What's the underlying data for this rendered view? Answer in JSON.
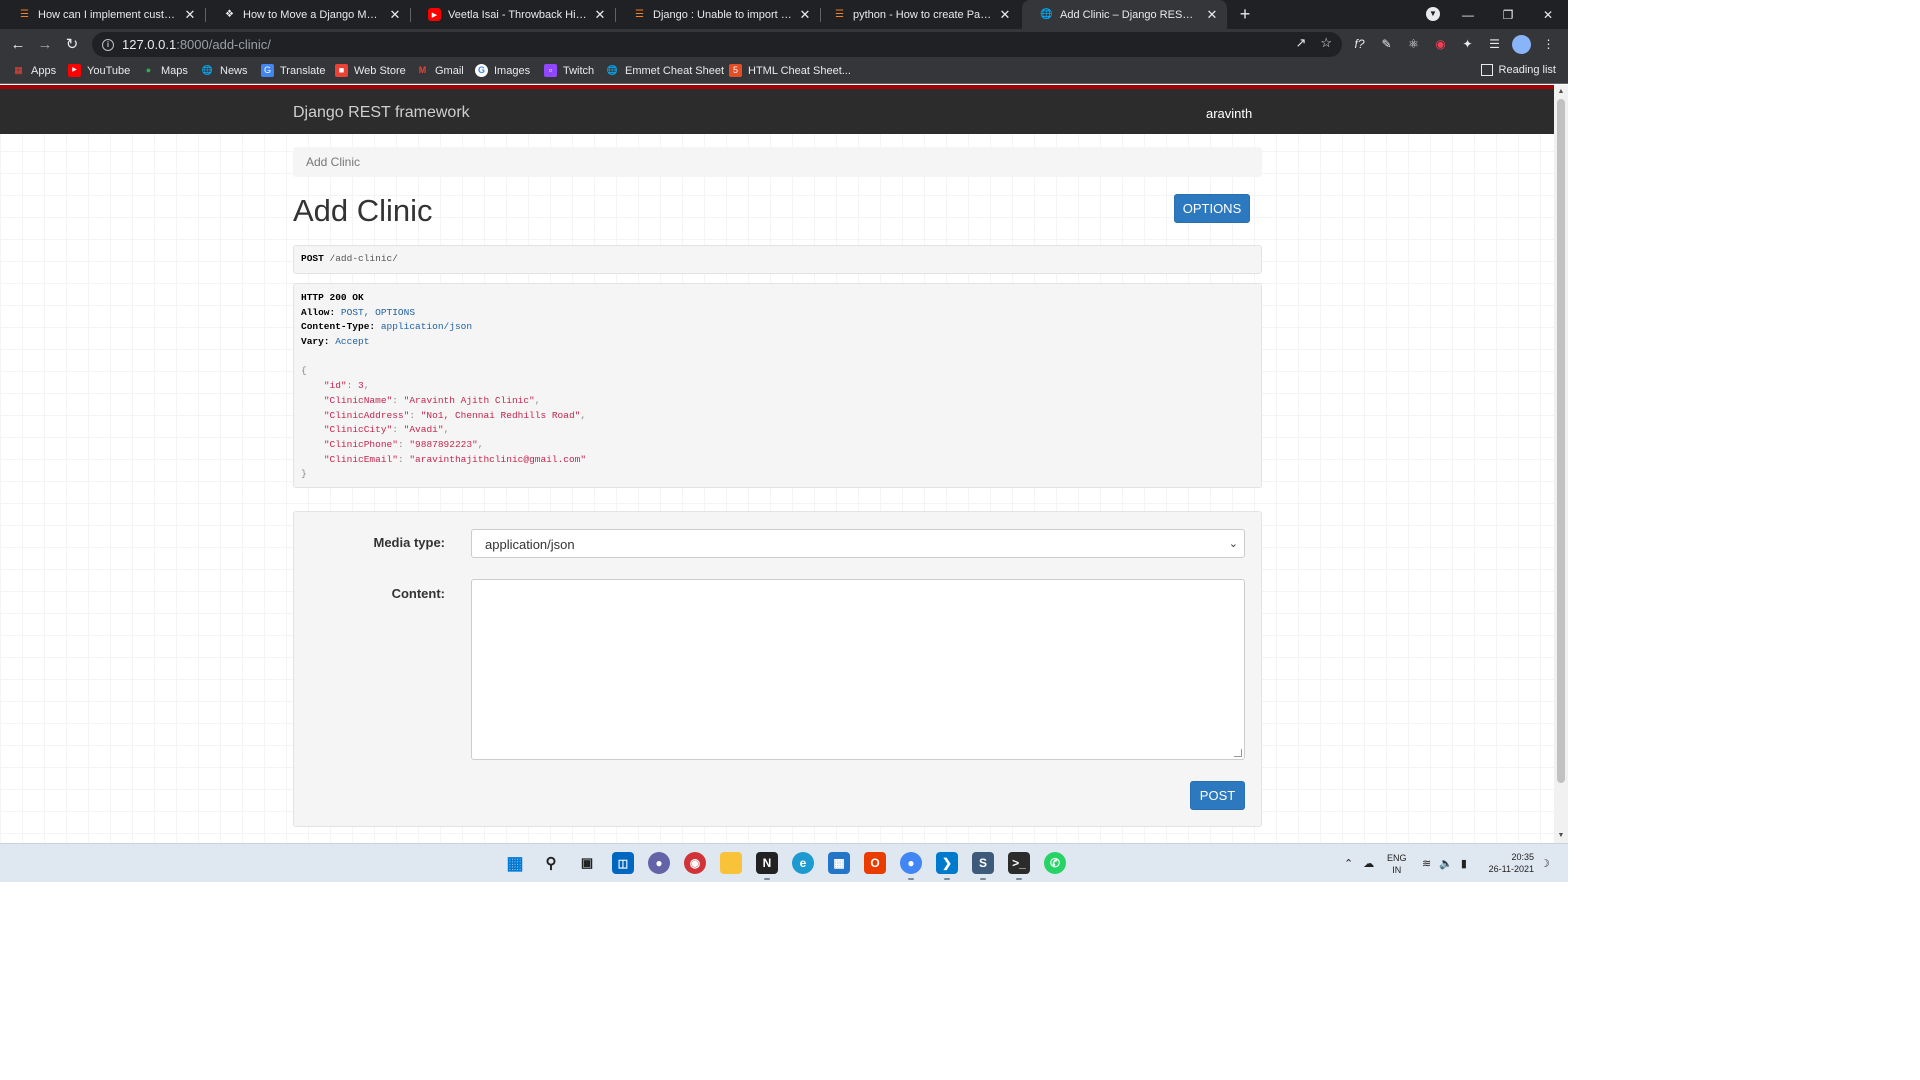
{
  "browser": {
    "tabs": [
      {
        "title": "How can I implement custom use",
        "icon": "stackoverflow-icon",
        "color": "#f48024"
      },
      {
        "title": "How to Move a Django Model to",
        "icon": "site-icon",
        "color": "#e8eaed"
      },
      {
        "title": "Veetla Isai - Throwback Hits Juke",
        "icon": "youtube-icon",
        "color": "#ff0000"
      },
      {
        "title": "Django : Unable to import mode",
        "icon": "stackoverflow-icon",
        "color": "#f48024"
      },
      {
        "title": "python - How to create Passwor",
        "icon": "stackoverflow-icon",
        "color": "#f48024"
      },
      {
        "title": "Add Clinic – Django REST framew",
        "icon": "globe-icon",
        "color": "#e8eaed"
      }
    ],
    "address": {
      "host": "127.0.0.1",
      "rest": ":8000/add-clinic/"
    },
    "bookmarks": [
      {
        "label": "Apps",
        "icon": "apps-grid-icon",
        "color": "#ea4335"
      },
      {
        "label": "YouTube",
        "icon": "youtube-icon",
        "color": "#ff0000"
      },
      {
        "label": "Maps",
        "icon": "maps-pin-icon",
        "color": "#34a853"
      },
      {
        "label": "News",
        "icon": "globe-icon",
        "color": "#e8eaed"
      },
      {
        "label": "Translate",
        "icon": "translate-icon",
        "color": "#4285f4"
      },
      {
        "label": "Web Store",
        "icon": "webstore-icon",
        "color": "#ea4335"
      },
      {
        "label": "Gmail",
        "icon": "gmail-icon",
        "color": "#ea4335"
      },
      {
        "label": "Images",
        "icon": "google-icon",
        "color": "#4285f4"
      },
      {
        "label": "Twitch",
        "icon": "twitch-icon",
        "color": "#9146ff"
      },
      {
        "label": "Emmet Cheat Sheet",
        "icon": "globe-icon",
        "color": "#e8eaed"
      },
      {
        "label": "HTML Cheat Sheet...",
        "icon": "html5-icon",
        "color": "#e44d26"
      }
    ],
    "reading_list": "Reading list"
  },
  "drf": {
    "brand": "Django REST framework",
    "user": "aravinth",
    "breadcrumb": "Add Clinic",
    "title": "Add Clinic",
    "options_label": "OPTIONS",
    "request": {
      "method": "POST",
      "path": "/add-clinic/"
    },
    "response": {
      "status": "HTTP 200 OK",
      "headers": [
        {
          "key": "Allow:",
          "value": "POST, OPTIONS"
        },
        {
          "key": "Content-Type:",
          "value": "application/json"
        },
        {
          "key": "Vary:",
          "value": "Accept"
        }
      ],
      "open_brace": "{",
      "close_brace": "}",
      "fields": [
        {
          "key": "\"id\"",
          "value": "3",
          "comma": ","
        },
        {
          "key": "\"ClinicName\"",
          "value": "\"Aravinth Ajith Clinic\"",
          "comma": ","
        },
        {
          "key": "\"ClinicAddress\"",
          "value": "\"No1, Chennai Redhills Road\"",
          "comma": ","
        },
        {
          "key": "\"ClinicCity\"",
          "value": "\"Avadi\"",
          "comma": ","
        },
        {
          "key": "\"ClinicPhone\"",
          "value": "\"9887892223\"",
          "comma": ","
        },
        {
          "key": "\"ClinicEmail\"",
          "value": "\"aravinthajithclinic@gmail.com\"",
          "comma": ""
        }
      ]
    },
    "form": {
      "media_type_label": "Media type:",
      "media_type_value": "application/json",
      "content_label": "Content:",
      "content_value": "",
      "post_label": "POST"
    },
    "colors": {
      "navbar": "#2c2c2c",
      "accent_red": "#a30000",
      "button": "#2c79c0"
    }
  },
  "taskbar": {
    "apps": [
      "windows-start-icon",
      "search-icon",
      "task-view-icon",
      "widgets-icon",
      "teams-chat-icon",
      "app-red-icon",
      "file-explorer-icon",
      "notion-icon",
      "edge-icon",
      "store-icon",
      "office-icon",
      "chrome-icon",
      "vscode-icon",
      "sublime-icon",
      "terminal-icon",
      "whatsapp-icon"
    ],
    "lang_top": "ENG",
    "lang_bottom": "IN",
    "time": "20:35",
    "date": "26-11-2021"
  }
}
